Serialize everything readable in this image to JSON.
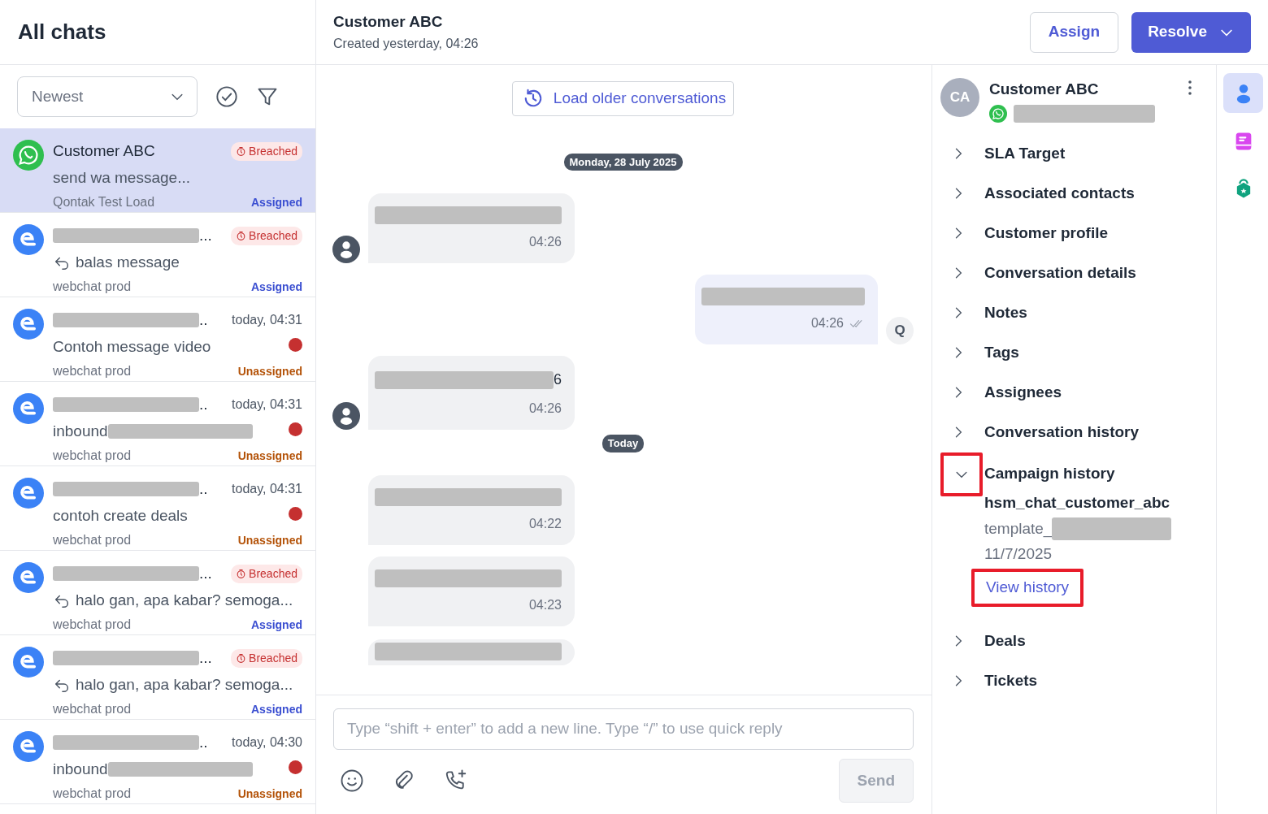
{
  "sidebar": {
    "title": "All chats",
    "sort": {
      "value": "Newest"
    },
    "chats": [
      {
        "kind": "whatsapp",
        "name": "Customer ABC",
        "name_redacted": false,
        "badge": "Breached",
        "reply": false,
        "preview": "send wa message...",
        "preview_redacted": false,
        "unread": false,
        "inbox": "Qontak Test Load",
        "status": "Assigned",
        "assigned": true,
        "selected": true
      },
      {
        "kind": "webchat",
        "name": "...",
        "name_redacted": true,
        "badge": "Breached",
        "reply": true,
        "preview": "balas message",
        "preview_redacted": false,
        "unread": false,
        "inbox": "webchat prod",
        "status": "Assigned",
        "assigned": true,
        "selected": false
      },
      {
        "kind": "webchat",
        "name": "..",
        "name_redacted": true,
        "time": "today, 04:31",
        "reply": false,
        "preview": "Contoh message video",
        "preview_redacted": false,
        "unread": true,
        "inbox": "webchat prod",
        "status": "Unassigned",
        "assigned": false,
        "selected": false
      },
      {
        "kind": "webchat",
        "name": "..",
        "name_redacted": true,
        "time": "today, 04:31",
        "reply": false,
        "preview": "inbound",
        "preview_redacted": true,
        "unread": true,
        "inbox": "webchat prod",
        "status": "Unassigned",
        "assigned": false,
        "selected": false
      },
      {
        "kind": "webchat",
        "name": "..",
        "name_redacted": true,
        "time": "today, 04:31",
        "reply": false,
        "preview": "contoh create deals",
        "preview_redacted": false,
        "unread": true,
        "inbox": "webchat prod",
        "status": "Unassigned",
        "assigned": false,
        "selected": false
      },
      {
        "kind": "webchat",
        "name": "...",
        "name_redacted": true,
        "badge": "Breached",
        "reply": true,
        "preview": "halo gan, apa kabar? semoga...",
        "preview_redacted": false,
        "unread": false,
        "inbox": "webchat prod",
        "status": "Assigned",
        "assigned": true,
        "selected": false
      },
      {
        "kind": "webchat",
        "name": "...",
        "name_redacted": true,
        "badge": "Breached",
        "reply": true,
        "preview": "halo gan, apa kabar? semoga...",
        "preview_redacted": false,
        "unread": false,
        "inbox": "webchat prod",
        "status": "Assigned",
        "assigned": true,
        "selected": false
      },
      {
        "kind": "webchat",
        "name": "..",
        "name_redacted": true,
        "time": "today, 04:30",
        "reply": false,
        "preview": "inbound",
        "preview_redacted": true,
        "unread": true,
        "inbox": "webchat prod",
        "status": "Unassigned",
        "assigned": false,
        "selected": false
      }
    ]
  },
  "header": {
    "title": "Customer ABC",
    "subtitle": "Created yesterday, 04:26",
    "buttons": [
      {
        "label": "Assign",
        "kind": "outline"
      },
      {
        "label": "Resolve",
        "kind": "primary"
      }
    ]
  },
  "conversation": {
    "load_older": "Load older conversations",
    "messages": [
      {
        "kind": "date",
        "label": "Monday, 28 July 2025"
      },
      {
        "kind": "incoming",
        "time": "04:26"
      },
      {
        "kind": "outgoing",
        "time": "04:26",
        "agent": "Q"
      },
      {
        "kind": "incoming",
        "time": "04:26",
        "text_tail": "6"
      },
      {
        "kind": "date",
        "label": "Today"
      },
      {
        "kind": "incoming",
        "time": "04:22"
      },
      {
        "kind": "incoming",
        "time": "04:23"
      },
      {
        "kind": "incoming_cut"
      }
    ]
  },
  "composer": {
    "placeholder": "Type “shift + enter” to add a new line. Type “/” to use quick reply",
    "send": {
      "label": "Send",
      "disabled": true
    }
  },
  "details": {
    "contact": {
      "initials": "CA",
      "name": "Customer ABC"
    },
    "sections": [
      {
        "label": "SLA Target",
        "expanded": false
      },
      {
        "label": "Associated contacts",
        "expanded": false
      },
      {
        "label": "Customer profile",
        "expanded": false
      },
      {
        "label": "Conversation details",
        "expanded": false
      },
      {
        "label": "Notes",
        "expanded": false
      },
      {
        "label": "Tags",
        "expanded": false
      },
      {
        "label": "Assignees",
        "expanded": false
      },
      {
        "label": "Conversation history",
        "expanded": false
      },
      {
        "label": "Campaign history",
        "expanded": true,
        "highlighted": true,
        "campaign": {
          "name": "hsm_chat_customer_abc",
          "template": "template_",
          "date": "11/7/2025",
          "link": {
            "label": "View history",
            "highlighted": true
          }
        }
      },
      {
        "label": "Deals",
        "expanded": false
      },
      {
        "label": "Tickets",
        "expanded": false
      }
    ]
  },
  "rail": [
    {
      "kind": "contact",
      "selected": true
    },
    {
      "kind": "notes",
      "selected": false
    },
    {
      "kind": "bag",
      "selected": false
    }
  ]
}
